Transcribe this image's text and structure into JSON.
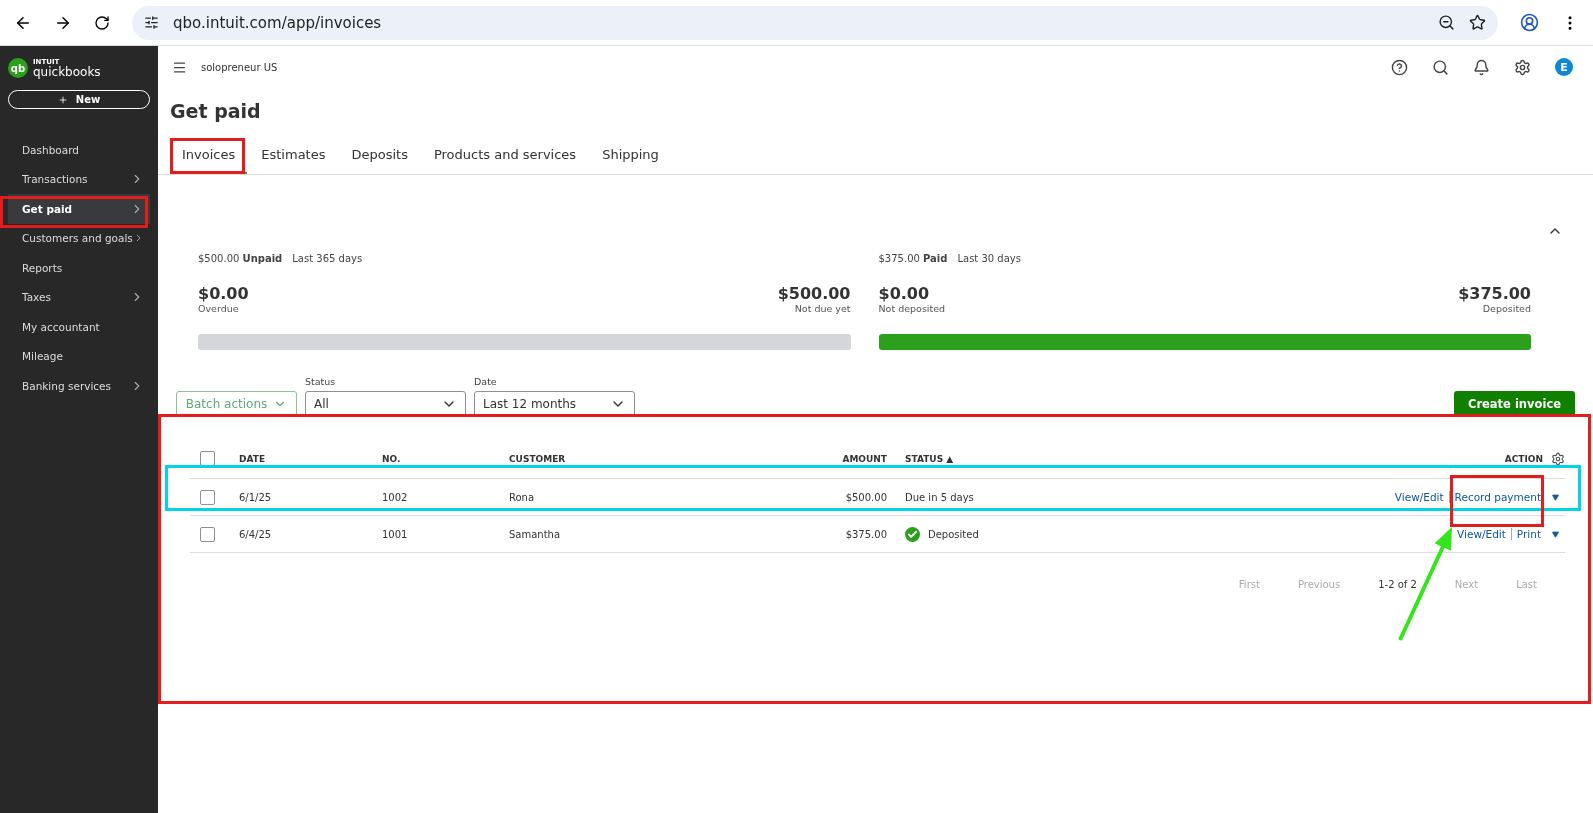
{
  "browser": {
    "url": "qbo.intuit.com/app/invoices"
  },
  "sidebar": {
    "logo_mark": "qb",
    "logo_top": "INTUIT",
    "logo_name": "quickbooks",
    "new_button": "New",
    "items": [
      {
        "label": "Dashboard",
        "selected": false,
        "has_submenu": false
      },
      {
        "label": "Transactions",
        "selected": false,
        "has_submenu": true
      },
      {
        "label": "Get paid",
        "selected": true,
        "has_submenu": true
      },
      {
        "label": "Customers and goals",
        "selected": false,
        "has_submenu": true
      },
      {
        "label": "Reports",
        "selected": false,
        "has_submenu": false
      },
      {
        "label": "Taxes",
        "selected": false,
        "has_submenu": true
      },
      {
        "label": "My accountant",
        "selected": false,
        "has_submenu": false
      },
      {
        "label": "Mileage",
        "selected": false,
        "has_submenu": false
      },
      {
        "label": "Banking services",
        "selected": false,
        "has_submenu": true
      }
    ]
  },
  "topbar": {
    "company": "solopreneur US",
    "avatar": "E"
  },
  "page_title": "Get paid",
  "tabs": [
    {
      "label": "Invoices",
      "selected": true
    },
    {
      "label": "Estimates",
      "selected": false
    },
    {
      "label": "Deposits",
      "selected": false
    },
    {
      "label": "Products and services",
      "selected": false
    },
    {
      "label": "Shipping",
      "selected": false
    }
  ],
  "summary": [
    {
      "amount_label": "$500.00",
      "title": "Unpaid",
      "period": "Last 365 days",
      "left_value": "$0.00",
      "left_caption": "Overdue",
      "right_value": "$500.00",
      "right_caption": "Not due yet",
      "level": 0,
      "kind": "unpaid"
    },
    {
      "amount_label": "$375.00",
      "title": "Paid",
      "period": "Last 30 days",
      "left_value": "$0.00",
      "left_caption": "Not deposited",
      "right_value": "$375.00",
      "right_caption": "Deposited",
      "level": 1,
      "kind": "paid"
    }
  ],
  "filters": {
    "batch_actions": "Batch actions",
    "status_label": "Status",
    "status_value": "All",
    "date_label": "Date",
    "date_value": "Last 12 months",
    "create_button": "Create invoice"
  },
  "table": {
    "select_all_checked": false,
    "columns": [
      "DATE",
      "NO.",
      "CUSTOMER",
      "AMOUNT",
      "STATUS ▲",
      "ACTION"
    ],
    "rows": [
      {
        "checked": false,
        "date": "6/1/25",
        "no": "1002",
        "customer": "Rona",
        "amount": "$500.00",
        "status": "Due in 5 days",
        "status_icon": false,
        "actions": [
          "View/Edit",
          "Record payment"
        ]
      },
      {
        "checked": false,
        "date": "6/4/25",
        "no": "1001",
        "customer": "Samantha",
        "amount": "$375.00",
        "status": "Deposited",
        "status_icon": true,
        "actions": [
          "View/Edit",
          "Print"
        ]
      }
    ]
  },
  "pagination": [
    {
      "label": "First",
      "disabled": true
    },
    {
      "label": "Previous",
      "disabled": true
    },
    {
      "label": "1-2 of 2",
      "disabled": false
    },
    {
      "label": "Next",
      "disabled": true
    },
    {
      "label": "Last",
      "disabled": true
    }
  ],
  "annotations": [
    {
      "kind": "box",
      "color": "#e31c1c"
    },
    {
      "kind": "box",
      "color": "#e31c1c"
    },
    {
      "kind": "box",
      "color": "#e31c1c"
    },
    {
      "kind": "box",
      "color": "#00d4e6"
    },
    {
      "kind": "box",
      "color": "#e31c1c"
    },
    {
      "kind": "arrow",
      "color": "#33e51a"
    }
  ]
}
